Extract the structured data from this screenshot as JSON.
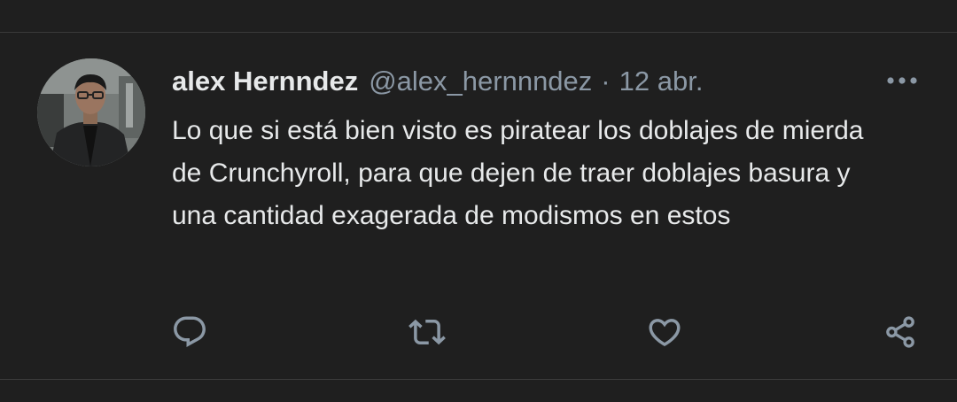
{
  "tweet": {
    "author": {
      "display_name": "alex Hernndez",
      "handle": "@alex_hernnndez",
      "avatar_icon": "user-photo-avatar"
    },
    "separator": "·",
    "timestamp": "12 abr.",
    "text": "Lo que si está bien visto es piratear los doblajes de mierda de Crunchyroll, para que dejen de traer doblajes basura y una cantidad exagerada de modismos en estos",
    "more_icon": "more-dots-icon",
    "actions": [
      {
        "name": "reply",
        "icon": "reply-icon"
      },
      {
        "name": "retweet",
        "icon": "retweet-icon"
      },
      {
        "name": "like",
        "icon": "heart-icon"
      },
      {
        "name": "share",
        "icon": "share-icon"
      }
    ]
  },
  "colors": {
    "background": "#1f1f1f",
    "primary_text": "#e7e9ea",
    "secondary_text": "#8b98a5",
    "divider": "#3a3a3a"
  }
}
